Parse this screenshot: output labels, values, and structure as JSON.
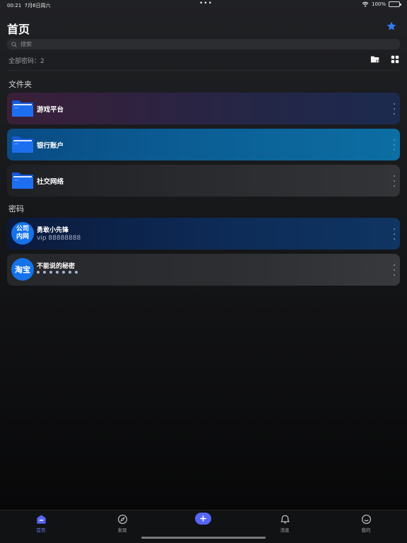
{
  "status_bar": {
    "time": "00:21",
    "date": "7月6日周六",
    "dots": "•••",
    "battery": "100%",
    "wifi_icon": "wifi-icon",
    "battery_icon": "battery-icon"
  },
  "header": {
    "title": "首页",
    "star_icon": "star-icon",
    "star_color": "#2f7bf5"
  },
  "search": {
    "placeholder": "搜索",
    "value": ""
  },
  "summary": {
    "count_text": "全部密码：2",
    "new_folder_icon": "new-folder-icon",
    "grid_icon": "grid-view-icon"
  },
  "folders_section": {
    "title": "文件夹"
  },
  "folders": [
    {
      "label": "游戏平台",
      "icon": "folder-icon"
    },
    {
      "label": "银行账户",
      "icon": "folder-icon",
      "selected": true
    },
    {
      "label": "社交网络",
      "icon": "folder-icon"
    }
  ],
  "passwords_section": {
    "title": "密码"
  },
  "passwords": [
    {
      "avatar": "公司内网",
      "avatar_line1": "公司",
      "avatar_line2": "内网",
      "title": "勇敢小先锋",
      "subtitle": "vip 88888888"
    },
    {
      "avatar": "淘宝",
      "title": "不能说的秘密",
      "subtitle_masked": true
    }
  ],
  "tabbar": {
    "items": [
      {
        "label": "首页",
        "icon": "home-icon",
        "active": true
      },
      {
        "label": "发现",
        "icon": "compass-icon"
      },
      {
        "label": "",
        "icon": "plus-icon"
      },
      {
        "label": "消息",
        "icon": "bell-icon"
      },
      {
        "label": "我的",
        "icon": "smile-icon"
      }
    ],
    "accent": "#5565f5"
  },
  "colors": {
    "accent": "#5565f5",
    "avatar_blue": "#1572e8",
    "folder_blue": "#1e6ff0"
  }
}
